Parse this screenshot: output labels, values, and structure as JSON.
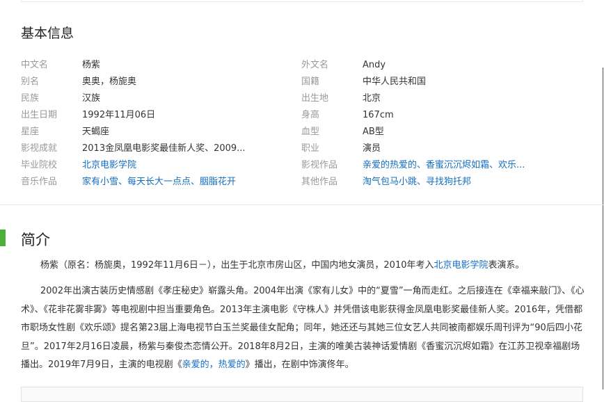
{
  "basic": {
    "title": "基本信息",
    "left": [
      {
        "label": "中文名",
        "value": "杨紫",
        "link": false
      },
      {
        "label": "别名",
        "value": "奥奥，杨旎奥",
        "link": false
      },
      {
        "label": "民族",
        "value": "汉族",
        "link": false
      },
      {
        "label": "出生日期",
        "value": "1992年11月06日",
        "link": false
      },
      {
        "label": "星座",
        "value": "天蝎座",
        "link": false
      },
      {
        "label": "影视成就",
        "value": "2013金凤凰电影奖最佳新人奖、2009...",
        "link": false
      },
      {
        "label": "毕业院校",
        "value": "北京电影学院",
        "link": true
      },
      {
        "label": "音乐作品",
        "value": "家有小雪、每天长大一点点、胭脂花开",
        "link": true
      }
    ],
    "right": [
      {
        "label": "外文名",
        "value": "Andy",
        "link": false
      },
      {
        "label": "国籍",
        "value": "中华人民共和国",
        "link": false
      },
      {
        "label": "出生地",
        "value": "北京",
        "link": false
      },
      {
        "label": "身高",
        "value": "167cm",
        "link": false
      },
      {
        "label": "血型",
        "value": "AB型",
        "link": false
      },
      {
        "label": "职业",
        "value": "演员",
        "link": false
      },
      {
        "label": "影视作品",
        "value": "亲爱的热爱的、香蜜沉沉烬如霜、欢乐...",
        "link": true
      },
      {
        "label": "其他作品",
        "value": "淘气包马小跳、寻找狗托邦",
        "link": true
      }
    ]
  },
  "intro": {
    "title": "简介",
    "p1": {
      "before": "杨紫（原名：杨旎奥，1992年11月6日－），出生于北京市房山区，中国内地女演员，2010年考入",
      "link": "北京电影学院",
      "after": "表演系。"
    },
    "p2": {
      "before": "2002年出演古装历史情感剧《孝庄秘史》崭露头角。2004年出演《家有儿女》中的“夏雪”一角而走红。之后接连在《幸福来敲门》、《心术》、《花非花雾非雾》等电视剧中担当重要角色。2013年主演电影《守株人》并凭借该电影获得金凤凰电影奖最佳新人奖。2016年，凭借都市职场女性剧《欢乐颂》提名第23届上海电视节白玉兰奖最佳女配角；同年，她还还与其她三位女艺人共同被南都娱乐周刊评为“90后四小花旦”。2017年2月16日凌晨，杨紫与秦俊杰恋情公开。2018年8月2日，主演的唯美古装神话爱情剧《香蜜沉沉烬如霜》在江苏卫视幸福剧场播出。2019年7月9日，主演的电视剧《",
      "link": "亲爱的，热爱的",
      "after": "》播出，在剧中饰演佟年。"
    }
  }
}
